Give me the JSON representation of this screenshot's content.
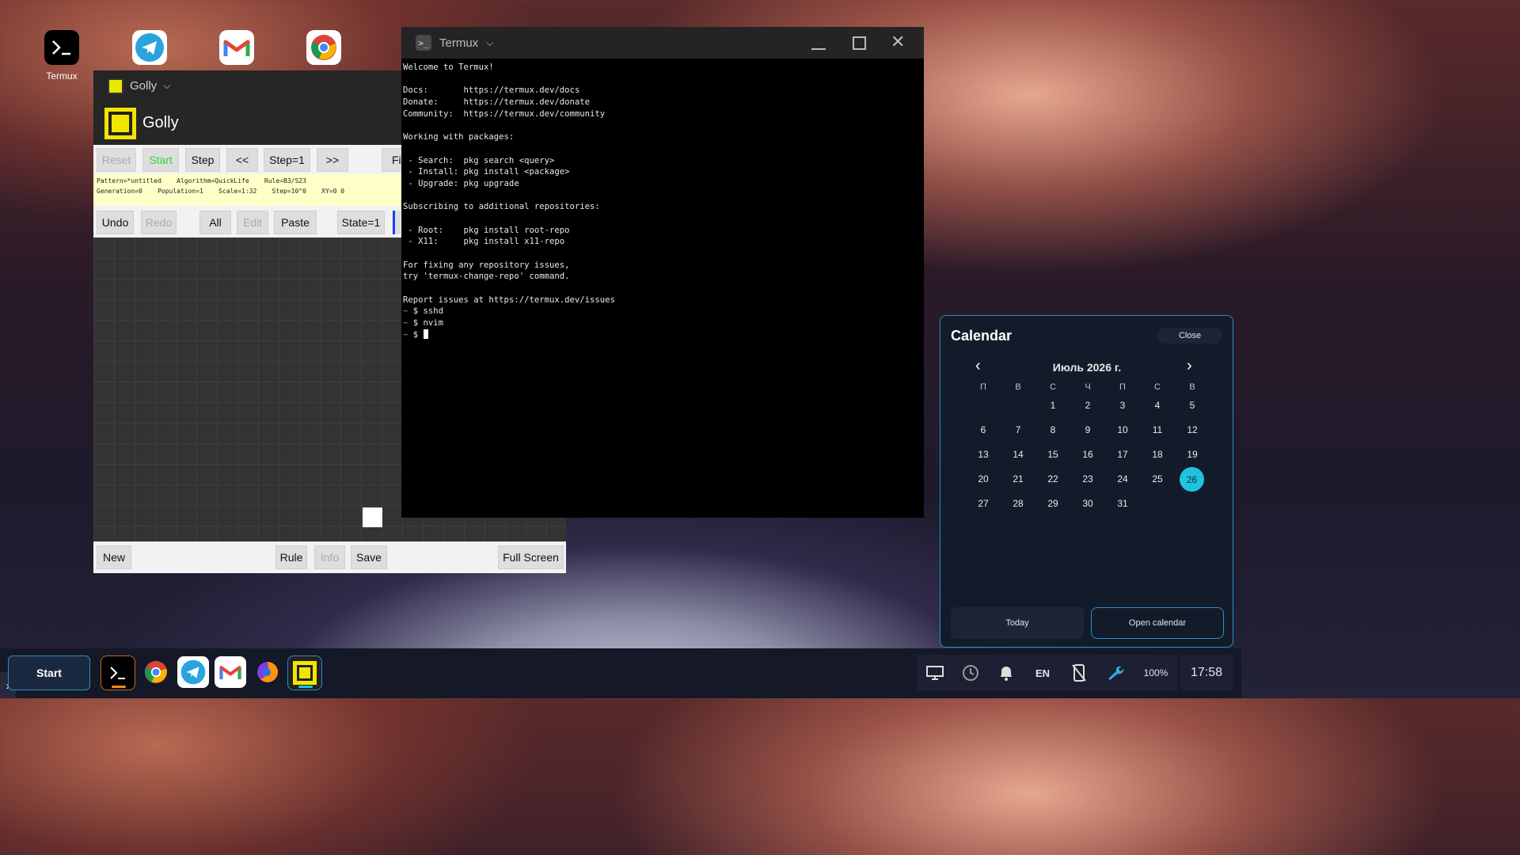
{
  "desktop": {
    "icons": [
      {
        "label": "Termux"
      }
    ]
  },
  "golly": {
    "window_title": "Golly",
    "app_title": "Golly",
    "toolbar1": [
      "Reset",
      "Start",
      "Step",
      "<<",
      "Step=1",
      ">>",
      "Fi"
    ],
    "info_line1": "Pattern=*untitled    Algorithm=QuickLife    Rule=B3/S23",
    "info_line2": "Generation=0    Population=1    Scale=1:32    Step=10^0    XY=0 0",
    "toolbar2": [
      "Undo",
      "Redo",
      "All",
      "Edit",
      "Paste",
      "State=1"
    ],
    "bottom": [
      "New",
      "Rule",
      "Info",
      "Save",
      "Full Screen"
    ]
  },
  "termux": {
    "window_title": "Termux",
    "lines": [
      "Welcome to Termux!",
      "",
      "Docs:       https://termux.dev/docs",
      "Donate:     https://termux.dev/donate",
      "Community:  https://termux.dev/community",
      "",
      "Working with packages:",
      "",
      " - Search:  pkg search <query>",
      " - Install: pkg install <package>",
      " - Upgrade: pkg upgrade",
      "",
      "Subscribing to additional repositories:",
      "",
      " - Root:    pkg install root-repo",
      " - X11:     pkg install x11-repo",
      "",
      "For fixing any repository issues,",
      "try 'termux-change-repo' command.",
      "",
      "Report issues at https://termux.dev/issues"
    ],
    "prompt_symbol": "~",
    "commands": [
      "$ sshd",
      "$ nvim",
      "$ "
    ]
  },
  "calendar": {
    "title": "Calendar",
    "close_label": "Close",
    "month_label": "Июль 2026 г.",
    "weekdays": [
      "П",
      "В",
      "С",
      "Ч",
      "П",
      "С",
      "В"
    ],
    "first_weekday_index": 2,
    "days_in_month": 31,
    "selected_day": 26,
    "today_label": "Today",
    "open_label": "Open calendar",
    "accent": "#1fc3e0"
  },
  "taskbar": {
    "start_label": "Start",
    "lang": "EN",
    "battery": "100%",
    "time": "17:58"
  }
}
